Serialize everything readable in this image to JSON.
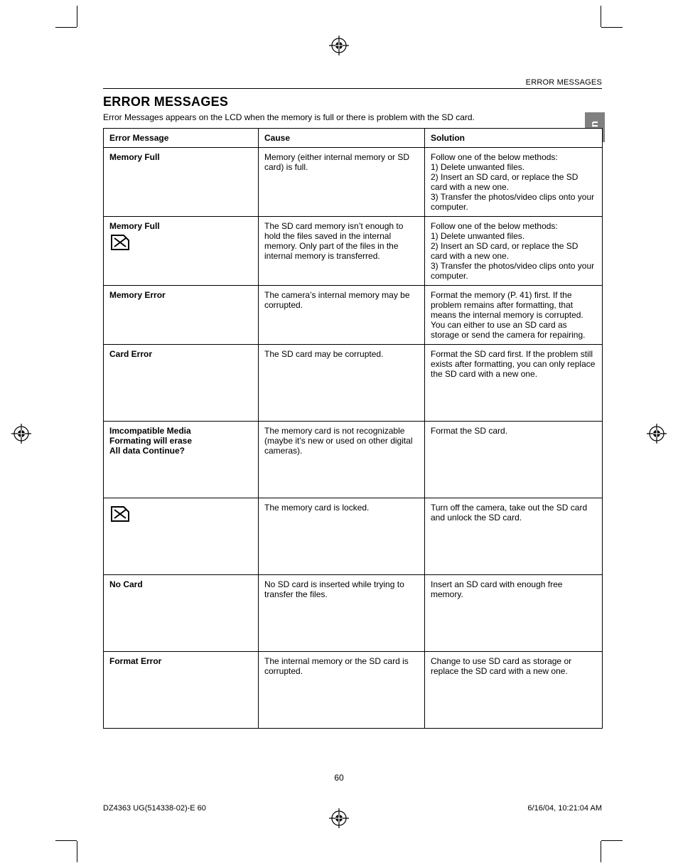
{
  "running_header": "ERROR MESSAGES",
  "lang_tab": "En",
  "heading": "ERROR MESSAGES",
  "intro": "Error Messages appears on the LCD when the memory is full or there is problem with the SD card.",
  "columns": {
    "c1": "Error Message",
    "c2": "Cause",
    "c3": "Solution"
  },
  "rows": [
    {
      "msg": "Memory Full",
      "icon": null,
      "cause": "Memory (either internal memory or SD card) is full.",
      "solution": "Follow one of the below methods:\n1) Delete unwanted files.\n2) Insert an SD card, or replace the SD card with a new one.\n3) Transfer the photos/video clips onto your computer."
    },
    {
      "msg": "Memory Full",
      "icon": "sd-cross",
      "cause": "The SD card memory isn’t enough to hold the files saved in the internal memory. Only part of the files in the internal memory is transferred.",
      "solution": "Follow one of the below methods:\n1) Delete unwanted files.\n2) Insert an SD card, or replace the SD card with a new one.\n3) Transfer the photos/video clips onto your computer."
    },
    {
      "msg": "Memory Error",
      "icon": null,
      "cause": "The camera’s internal memory may be corrupted.",
      "solution": "Format the memory (P. 41) first. If the problem remains after formatting, that means the internal memory is corrupted. You can either to use an SD card as storage or send the camera for repairing."
    },
    {
      "msg": "Card Error",
      "icon": null,
      "cause": "The SD card may be corrupted.",
      "solution": "Format the SD card first. If the problem still exists after formatting, you can only replace the SD card with a new one."
    },
    {
      "msg_lines": [
        "Imcompatible Media",
        "Formating will erase",
        "All data Continue?"
      ],
      "icon": null,
      "cause": "The memory card is not recognizable (maybe it’s new or used on other digital cameras).",
      "solution": "Format the SD card."
    },
    {
      "msg": "",
      "icon": "sd-cross",
      "cause": "The memory card is locked.",
      "solution": "Turn off the camera, take out the SD card and unlock the SD card."
    },
    {
      "msg": "No Card",
      "icon": null,
      "cause": "No SD card is inserted while trying to transfer the files.",
      "solution": "Insert an SD card with enough free memory."
    },
    {
      "msg": "Format Error",
      "icon": null,
      "cause": "The internal memory or the SD card is corrupted.",
      "solution": "Change to use SD card as storage or replace the SD card with a new one."
    }
  ],
  "page_number": "60",
  "footer_left": "DZ4363 UG(514338-02)-E   60",
  "footer_right": "6/16/04, 10:21:04 AM"
}
